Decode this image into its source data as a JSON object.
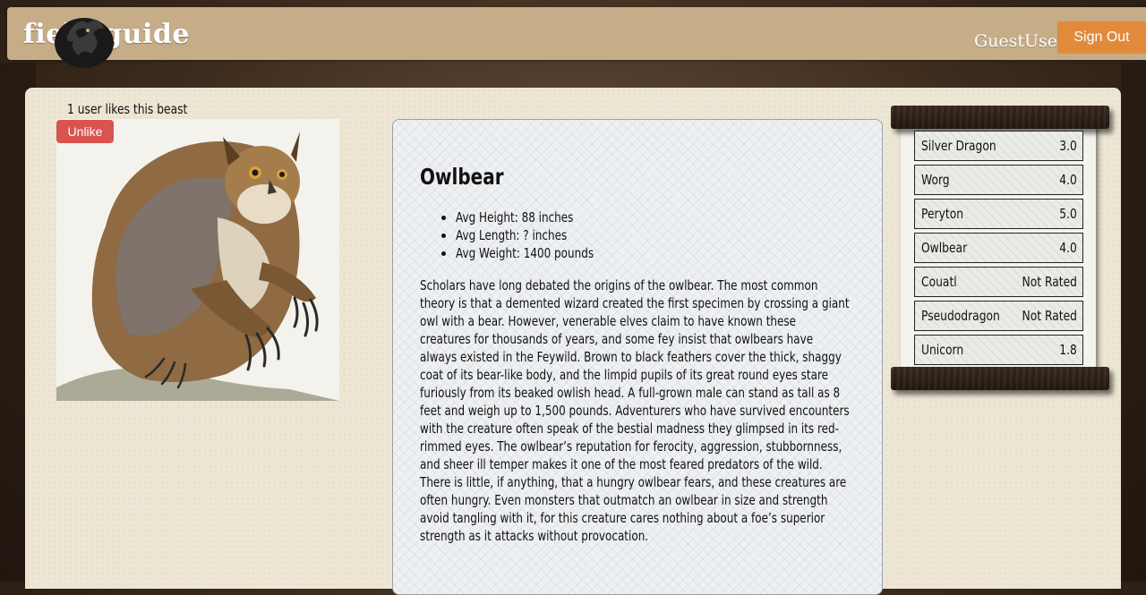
{
  "header": {
    "logo_text": "field guide",
    "username": "GuestUser",
    "sign_out_label": "Sign Out"
  },
  "beast": {
    "likes_text": "1 user likes this beast",
    "unlike_label": "Unlike",
    "name": "Owlbear",
    "stats": [
      "Avg Height: 88 inches",
      "Avg Length: ? inches",
      "Avg Weight: 1400 pounds"
    ],
    "description": "Scholars have long debated the origins of the owlbear. The most common theory is that a demented wizard created the first specimen by crossing a giant owl with a bear. However, venerable elves claim to have known these creatures for thousands of years, and some fey insist that owlbears have always existed in the Feywild. Brown to black feathers cover the thick, shaggy coat of its bear-like body, and the limpid pupils of its great round eyes stare furiously from its beaked owlish head. A full-grown male can stand as tall as 8 feet and weigh up to 1,500 pounds. Adventurers who have survived encounters with the creature often speak of the bestial madness they glimpsed in its red-rimmed eyes. The owlbear’s reputation for ferocity, aggression, stubbornness, and sheer ill temper makes it one of the most feared predators of the wild. There is little, if anything, that a hungry owlbear fears, and these creatures are often hungry. Even monsters that outmatch an owlbear in size and strength avoid tangling with it, for this creature cares nothing about a foe’s superior strength as it attacks without provocation."
  },
  "leaderboard": [
    {
      "name": "Silver Dragon",
      "score": "3.0"
    },
    {
      "name": "Worg",
      "score": "4.0"
    },
    {
      "name": "Peryton",
      "score": "5.0"
    },
    {
      "name": "Owlbear",
      "score": "4.0"
    },
    {
      "name": "Couatl",
      "score": "Not Rated"
    },
    {
      "name": "Pseudodragon",
      "score": "Not Rated"
    },
    {
      "name": "Unicorn",
      "score": "1.8"
    }
  ],
  "colors": {
    "header": "#c6ad88",
    "sign_out": "#e28a3c",
    "unlike": "#d9534f",
    "panel": "#ede6d4"
  }
}
